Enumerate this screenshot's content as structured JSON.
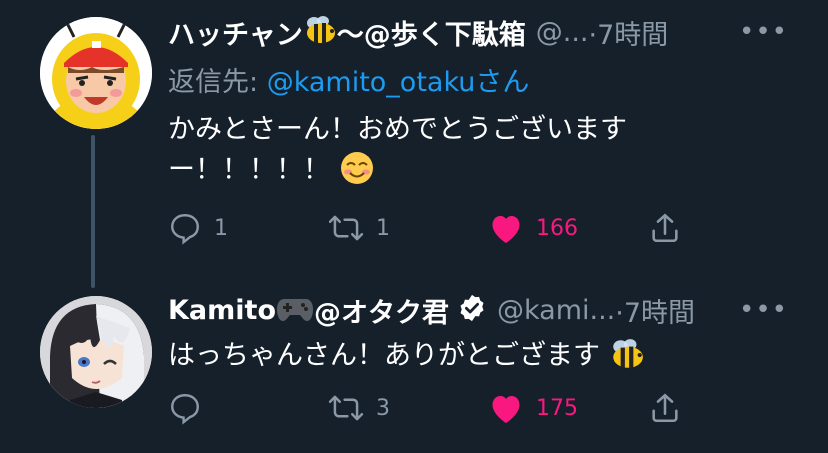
{
  "tweets": [
    {
      "display_name": "ハッチャン",
      "name_suffix": "〜@歩く下駄箱",
      "name_emoji": "bee-emoji",
      "handle": "@...",
      "time": "·7時間",
      "more_label": "•••",
      "reply_prefix": "返信先: ",
      "reply_mention": "@kamito_otaku",
      "reply_suffix": "さん",
      "text_line1": "かみとさーん！おめでとうございます",
      "text_line2": "ー！！！！！",
      "text_emoji": "smiling-face-emoji",
      "replies": "1",
      "retweets": "1",
      "likes": "166",
      "avatar_icon": "cartoon-boy-avatar"
    },
    {
      "display_name": "Kamito",
      "name_suffix": "@オタク君",
      "name_emoji": "game-controller-emoji",
      "verified": "verified-badge",
      "handle": "@kami...",
      "time": "·7時間",
      "more_label": "•••",
      "text": "はっちゃんさん！ありがとござます",
      "text_emoji": "bee-emoji",
      "replies": "",
      "retweets": "3",
      "likes": "175",
      "avatar_icon": "anime-character-avatar"
    }
  ],
  "colors": {
    "background": "#15202b",
    "primary_text": "#ffffff",
    "secondary_text": "#8b98a5",
    "link": "#1d9bf0",
    "like": "#f91880",
    "thread_line": "#3d5466"
  }
}
